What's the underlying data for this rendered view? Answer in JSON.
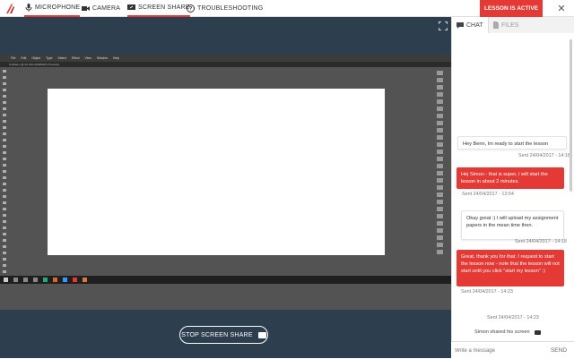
{
  "topbar": {
    "nav": [
      {
        "label": "MICROPHONE",
        "icon": "microphone-icon",
        "active": true
      },
      {
        "label": "CAMERA",
        "icon": "camera-icon",
        "active": false
      },
      {
        "label": "SCREEN SHARE",
        "icon": "screen-share-icon",
        "active": true
      },
      {
        "label": "TROUBLESHOOTING",
        "icon": "question-icon",
        "active": false
      }
    ],
    "lesson_status": "LESSON IS ACTIVE",
    "close_symbol": "✕"
  },
  "stage": {
    "stop_button_label": "STOP SCREEN SHARE"
  },
  "shared_screen": {
    "menu": [
      "File",
      "Edit",
      "Object",
      "Type",
      "Select",
      "Effect",
      "View",
      "Window",
      "Help"
    ],
    "tab_label": "Untitled-1 @ 42.13% (RGB/GPU Preview)"
  },
  "panel": {
    "tabs": [
      {
        "label": "CHAT",
        "icon": "chat-icon"
      },
      {
        "label": "FILES",
        "icon": "file-icon"
      }
    ],
    "messages": [
      {
        "direction": "in",
        "text": "Hey Benn, Im ready to start the lesson",
        "meta": "Sent 24/04/2017 - 14:18"
      },
      {
        "direction": "out",
        "text": "Hej Simon - that is super, I will start the lesson in about 2 minutes.",
        "meta": "Sent 24/04/2017 - 13:54"
      },
      {
        "direction": "in",
        "text": "Okay great :) I will upload my assignment papers in the mean time then.",
        "meta": "Sent 24/04/2017 - 14:18"
      },
      {
        "direction": "out",
        "text": "Great, thank you for that. I request to start the lesson now - note that the lesson will not start until you click \"start my lesson\" :)",
        "meta": "Sent 24/04/2017 - 14:23"
      }
    ],
    "system_message": {
      "text": "Simon shared his screen",
      "meta": "Sent 24/04/2017 - 14:23"
    },
    "composer": {
      "placeholder": "Write a message",
      "send_label": "SEND"
    }
  },
  "colors": {
    "accent": "#e53935",
    "stage_bg": "#2d3e4f"
  }
}
